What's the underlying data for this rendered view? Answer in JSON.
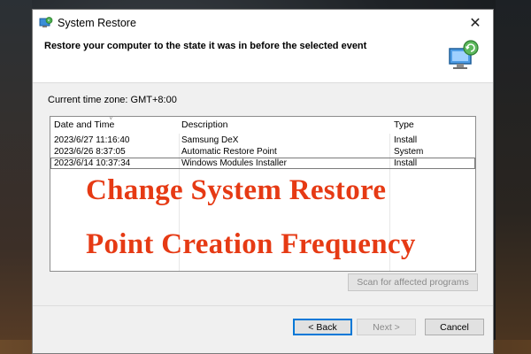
{
  "window": {
    "title": "System Restore",
    "close_glyph": "✕"
  },
  "header": {
    "heading": "Restore your computer to the state it was in before the selected event",
    "icon": "system-restore-icon"
  },
  "timezone": {
    "label": "Current time zone: GMT+8:00"
  },
  "table": {
    "columns": [
      "Date and Time",
      "Description",
      "Type"
    ],
    "rows": [
      {
        "date": "2023/6/27 11:16:40",
        "description": "Samsung DeX",
        "type": "Install"
      },
      {
        "date": "2023/6/26 8:37:05",
        "description": "Automatic Restore Point",
        "type": "System"
      },
      {
        "date": "2023/6/14 10:37:34",
        "description": "Windows Modules Installer",
        "type": "Install"
      }
    ],
    "selected_row": 2
  },
  "overlay": {
    "line1": "Change System Restore",
    "line2": "Point Creation Frequency",
    "color": "#e63a14"
  },
  "buttons": {
    "scan": "Scan for affected programs",
    "back": "< Back",
    "next": "Next >",
    "cancel": "Cancel"
  },
  "colors": {
    "accent": "#0078d7",
    "window_bg": "#f0f0f0"
  }
}
